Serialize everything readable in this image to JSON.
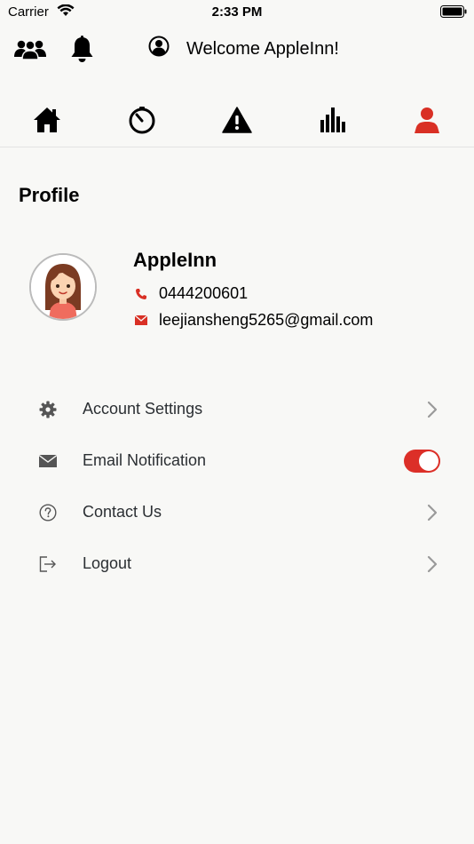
{
  "status_bar": {
    "carrier": "Carrier",
    "time": "2:33 PM"
  },
  "header": {
    "welcome_text": "Welcome AppleInn!"
  },
  "nav": {
    "items": [
      "home-icon",
      "timer-icon",
      "alert-icon",
      "stats-icon",
      "profile-icon"
    ],
    "active_color": "#d93025"
  },
  "page": {
    "title": "Profile"
  },
  "profile": {
    "name": "AppleInn",
    "phone": "0444200601",
    "email": "leejiansheng5265@gmail.com"
  },
  "menu": {
    "account_settings": "Account Settings",
    "email_notification": "Email Notification",
    "contact_us": "Contact Us",
    "logout": "Logout"
  },
  "colors": {
    "accent": "#dc2f28",
    "text": "#2b2f33"
  }
}
